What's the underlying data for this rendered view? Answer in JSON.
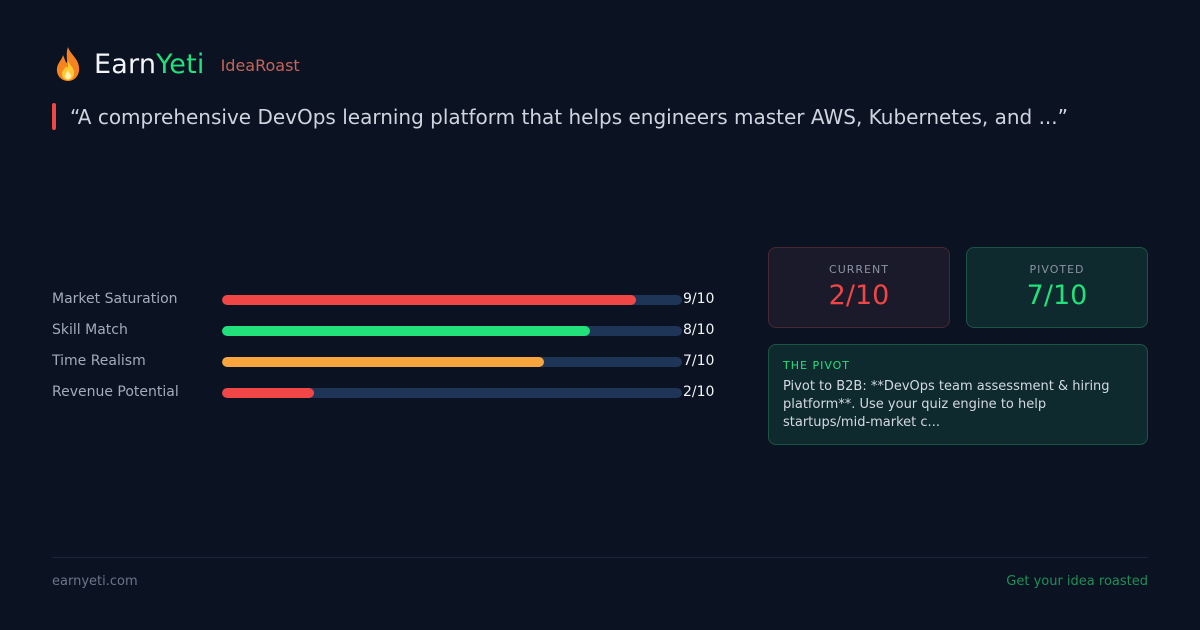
{
  "header": {
    "brand_part1": "Earn",
    "brand_part2": "Yeti",
    "product": "IdeaRoast",
    "logo_icon": "flame-icon"
  },
  "quote": {
    "text": "“A comprehensive DevOps learning platform that helps engineers master AWS, Kubernetes, and ...”"
  },
  "metrics": [
    {
      "label": "Market Saturation",
      "score": "9/10",
      "value": 9,
      "max": 10,
      "color": "#f04646"
    },
    {
      "label": "Skill Match",
      "score": "8/10",
      "value": 8,
      "max": 10,
      "color": "#22e07a"
    },
    {
      "label": "Time Realism",
      "score": "7/10",
      "value": 7,
      "max": 10,
      "color": "#f7a53c"
    },
    {
      "label": "Revenue Potential",
      "score": "2/10",
      "value": 2,
      "max": 10,
      "color": "#f04646"
    }
  ],
  "cards": {
    "current": {
      "caption": "CURRENT",
      "value": "2/10"
    },
    "pivoted": {
      "caption": "PIVOTED",
      "value": "7/10"
    }
  },
  "pivot": {
    "title": "THE PIVOT",
    "body": "Pivot to B2B: **DevOps team assessment & hiring platform**. Use your quiz engine to help startups/mid-market c..."
  },
  "footer": {
    "site": "earnyeti.com",
    "cta": "Get your idea roasted"
  },
  "colors": {
    "background": "#0b1222",
    "accent_green": "#22e07a",
    "accent_red": "#f04646",
    "accent_orange": "#f7a53c"
  }
}
